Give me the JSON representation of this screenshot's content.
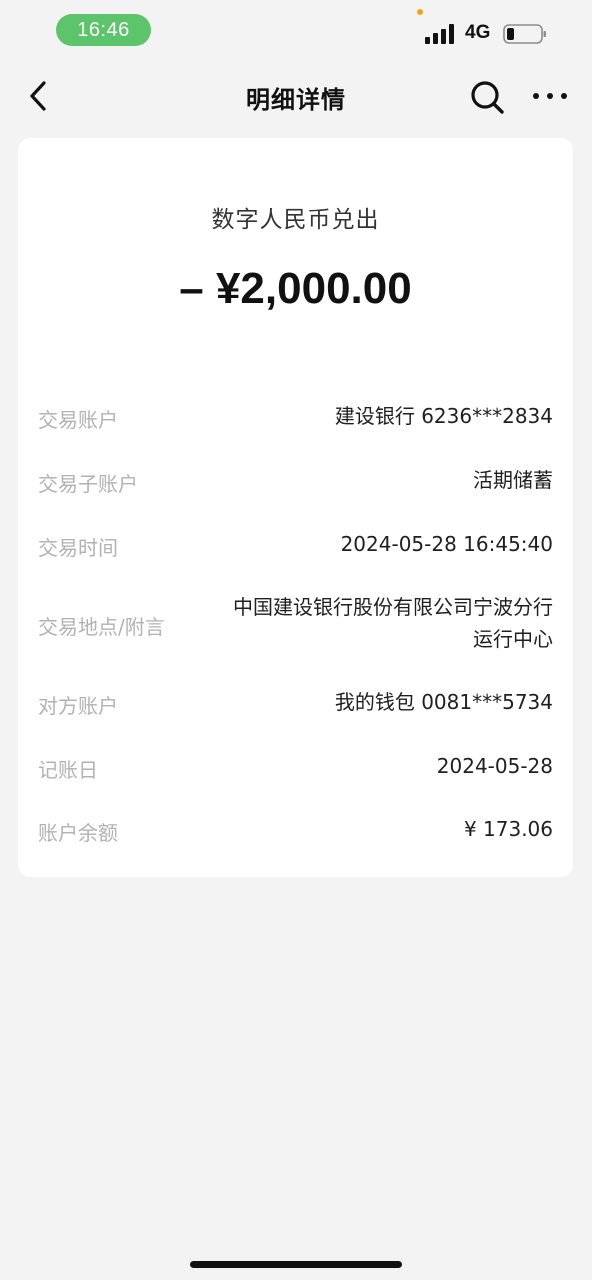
{
  "status_bar": {
    "time": "16:46",
    "network": "4G"
  },
  "nav": {
    "title": "明细详情"
  },
  "detail": {
    "type": "数字人民币兑出",
    "amount": "– ¥2,000.00",
    "rows": [
      {
        "label": "交易账户",
        "value": "建设银行 6236***2834"
      },
      {
        "label": "交易子账户",
        "value": "活期储蓄"
      },
      {
        "label": "交易时间",
        "value": "2024-05-28 16:45:40"
      },
      {
        "label": "交易地点/附言",
        "value_line1": "中国建设银行股份有限公司宁波分行",
        "value_line2": "运行中心"
      },
      {
        "label": "对方账户",
        "value": "我的钱包 0081***5734"
      },
      {
        "label": "记账日",
        "value": "2024-05-28"
      },
      {
        "label": "账户余额",
        "value": "¥ 173.06"
      }
    ]
  },
  "colors": {
    "time_pill": "#5cc46a",
    "background": "#f3f3f3",
    "card": "#ffffff",
    "label": "#b2b2b2"
  },
  "icons": {
    "back": "chevron-left-icon",
    "search": "search-icon",
    "more": "more-dots-icon",
    "signal": "signal-icon",
    "battery": "battery-icon"
  }
}
